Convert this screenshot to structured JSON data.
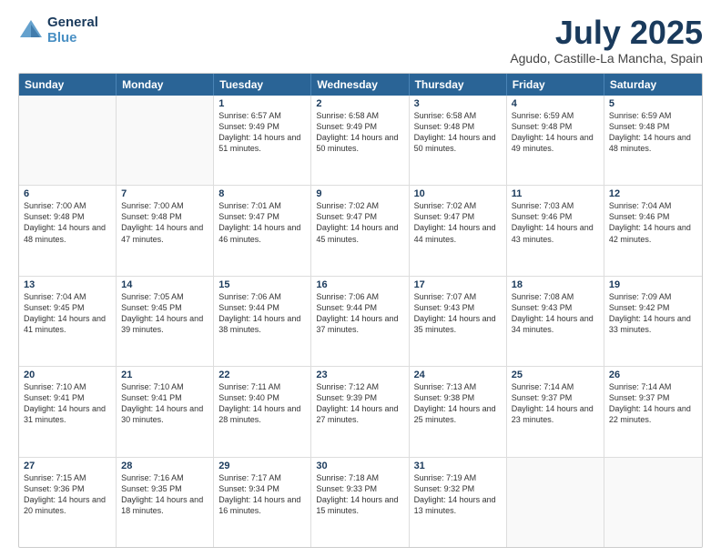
{
  "header": {
    "logo_line1": "General",
    "logo_line2": "Blue",
    "title": "July 2025",
    "subtitle": "Agudo, Castille-La Mancha, Spain"
  },
  "days_of_week": [
    "Sunday",
    "Monday",
    "Tuesday",
    "Wednesday",
    "Thursday",
    "Friday",
    "Saturday"
  ],
  "rows": [
    [
      {
        "day": "",
        "info": "",
        "empty": true
      },
      {
        "day": "",
        "info": "",
        "empty": true
      },
      {
        "day": "1",
        "info": "Sunrise: 6:57 AM\nSunset: 9:49 PM\nDaylight: 14 hours and 51 minutes."
      },
      {
        "day": "2",
        "info": "Sunrise: 6:58 AM\nSunset: 9:49 PM\nDaylight: 14 hours and 50 minutes."
      },
      {
        "day": "3",
        "info": "Sunrise: 6:58 AM\nSunset: 9:48 PM\nDaylight: 14 hours and 50 minutes."
      },
      {
        "day": "4",
        "info": "Sunrise: 6:59 AM\nSunset: 9:48 PM\nDaylight: 14 hours and 49 minutes."
      },
      {
        "day": "5",
        "info": "Sunrise: 6:59 AM\nSunset: 9:48 PM\nDaylight: 14 hours and 48 minutes."
      }
    ],
    [
      {
        "day": "6",
        "info": "Sunrise: 7:00 AM\nSunset: 9:48 PM\nDaylight: 14 hours and 48 minutes."
      },
      {
        "day": "7",
        "info": "Sunrise: 7:00 AM\nSunset: 9:48 PM\nDaylight: 14 hours and 47 minutes."
      },
      {
        "day": "8",
        "info": "Sunrise: 7:01 AM\nSunset: 9:47 PM\nDaylight: 14 hours and 46 minutes."
      },
      {
        "day": "9",
        "info": "Sunrise: 7:02 AM\nSunset: 9:47 PM\nDaylight: 14 hours and 45 minutes."
      },
      {
        "day": "10",
        "info": "Sunrise: 7:02 AM\nSunset: 9:47 PM\nDaylight: 14 hours and 44 minutes."
      },
      {
        "day": "11",
        "info": "Sunrise: 7:03 AM\nSunset: 9:46 PM\nDaylight: 14 hours and 43 minutes."
      },
      {
        "day": "12",
        "info": "Sunrise: 7:04 AM\nSunset: 9:46 PM\nDaylight: 14 hours and 42 minutes."
      }
    ],
    [
      {
        "day": "13",
        "info": "Sunrise: 7:04 AM\nSunset: 9:45 PM\nDaylight: 14 hours and 41 minutes."
      },
      {
        "day": "14",
        "info": "Sunrise: 7:05 AM\nSunset: 9:45 PM\nDaylight: 14 hours and 39 minutes."
      },
      {
        "day": "15",
        "info": "Sunrise: 7:06 AM\nSunset: 9:44 PM\nDaylight: 14 hours and 38 minutes."
      },
      {
        "day": "16",
        "info": "Sunrise: 7:06 AM\nSunset: 9:44 PM\nDaylight: 14 hours and 37 minutes."
      },
      {
        "day": "17",
        "info": "Sunrise: 7:07 AM\nSunset: 9:43 PM\nDaylight: 14 hours and 35 minutes."
      },
      {
        "day": "18",
        "info": "Sunrise: 7:08 AM\nSunset: 9:43 PM\nDaylight: 14 hours and 34 minutes."
      },
      {
        "day": "19",
        "info": "Sunrise: 7:09 AM\nSunset: 9:42 PM\nDaylight: 14 hours and 33 minutes."
      }
    ],
    [
      {
        "day": "20",
        "info": "Sunrise: 7:10 AM\nSunset: 9:41 PM\nDaylight: 14 hours and 31 minutes."
      },
      {
        "day": "21",
        "info": "Sunrise: 7:10 AM\nSunset: 9:41 PM\nDaylight: 14 hours and 30 minutes."
      },
      {
        "day": "22",
        "info": "Sunrise: 7:11 AM\nSunset: 9:40 PM\nDaylight: 14 hours and 28 minutes."
      },
      {
        "day": "23",
        "info": "Sunrise: 7:12 AM\nSunset: 9:39 PM\nDaylight: 14 hours and 27 minutes."
      },
      {
        "day": "24",
        "info": "Sunrise: 7:13 AM\nSunset: 9:38 PM\nDaylight: 14 hours and 25 minutes."
      },
      {
        "day": "25",
        "info": "Sunrise: 7:14 AM\nSunset: 9:37 PM\nDaylight: 14 hours and 23 minutes."
      },
      {
        "day": "26",
        "info": "Sunrise: 7:14 AM\nSunset: 9:37 PM\nDaylight: 14 hours and 22 minutes."
      }
    ],
    [
      {
        "day": "27",
        "info": "Sunrise: 7:15 AM\nSunset: 9:36 PM\nDaylight: 14 hours and 20 minutes."
      },
      {
        "day": "28",
        "info": "Sunrise: 7:16 AM\nSunset: 9:35 PM\nDaylight: 14 hours and 18 minutes."
      },
      {
        "day": "29",
        "info": "Sunrise: 7:17 AM\nSunset: 9:34 PM\nDaylight: 14 hours and 16 minutes."
      },
      {
        "day": "30",
        "info": "Sunrise: 7:18 AM\nSunset: 9:33 PM\nDaylight: 14 hours and 15 minutes."
      },
      {
        "day": "31",
        "info": "Sunrise: 7:19 AM\nSunset: 9:32 PM\nDaylight: 14 hours and 13 minutes."
      },
      {
        "day": "",
        "info": "",
        "empty": true
      },
      {
        "day": "",
        "info": "",
        "empty": true
      }
    ]
  ]
}
